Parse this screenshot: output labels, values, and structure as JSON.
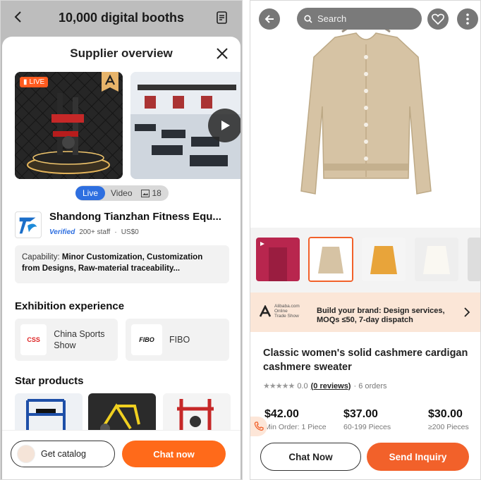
{
  "left": {
    "header_title": "10,000 digital booths",
    "sheet_title": "Supplier overview",
    "live_badge": "LIVE",
    "media_tabs": {
      "live": "Live",
      "video": "Video",
      "photo_count": "18"
    },
    "supplier": {
      "name": "Shandong Tianzhan Fitness Equ...",
      "verified": "Verified",
      "staff": "200+ staff",
      "revenue": "US$0"
    },
    "capability": {
      "label": "Capability:",
      "value": "Minor Customization, Customization from Designs, Raw-material traceability..."
    },
    "exhibition_title": "Exhibition experience",
    "exhibitions": [
      {
        "name": "China Sports Show",
        "logo_text": "CSS"
      },
      {
        "name": "FIBO",
        "logo_text": "FIBO"
      }
    ],
    "star_products_title": "Star products",
    "buttons": {
      "catalog": "Get catalog",
      "chat": "Chat now"
    }
  },
  "right": {
    "search_placeholder": "Search",
    "promo": {
      "logo_line1": "Alibaba.com",
      "logo_line2": "Online",
      "logo_line3": "Trade Show",
      "line1": "Build your brand: Design services,",
      "line2": "MOQs ≤50, 7-day dispatch"
    },
    "product_title": "Classic women's solid cashmere cardigan cashmere sweater",
    "rating": {
      "score": "0.0",
      "reviews": "(0 reviews)",
      "orders": "· 6 orders"
    },
    "prices": [
      {
        "price": "$42.00",
        "qty": "Min Order: 1 Piece"
      },
      {
        "price": "$37.00",
        "qty": "60-199 Pieces"
      },
      {
        "price": "$30.00",
        "qty": "≥200 Pieces"
      }
    ],
    "buttons": {
      "chat": "Chat Now",
      "inquiry": "Send Inquiry"
    }
  },
  "colors": {
    "accent_orange": "#ff6a1a",
    "live_blue": "#2e6fe0",
    "promo_bg": "#fbe6d7"
  }
}
